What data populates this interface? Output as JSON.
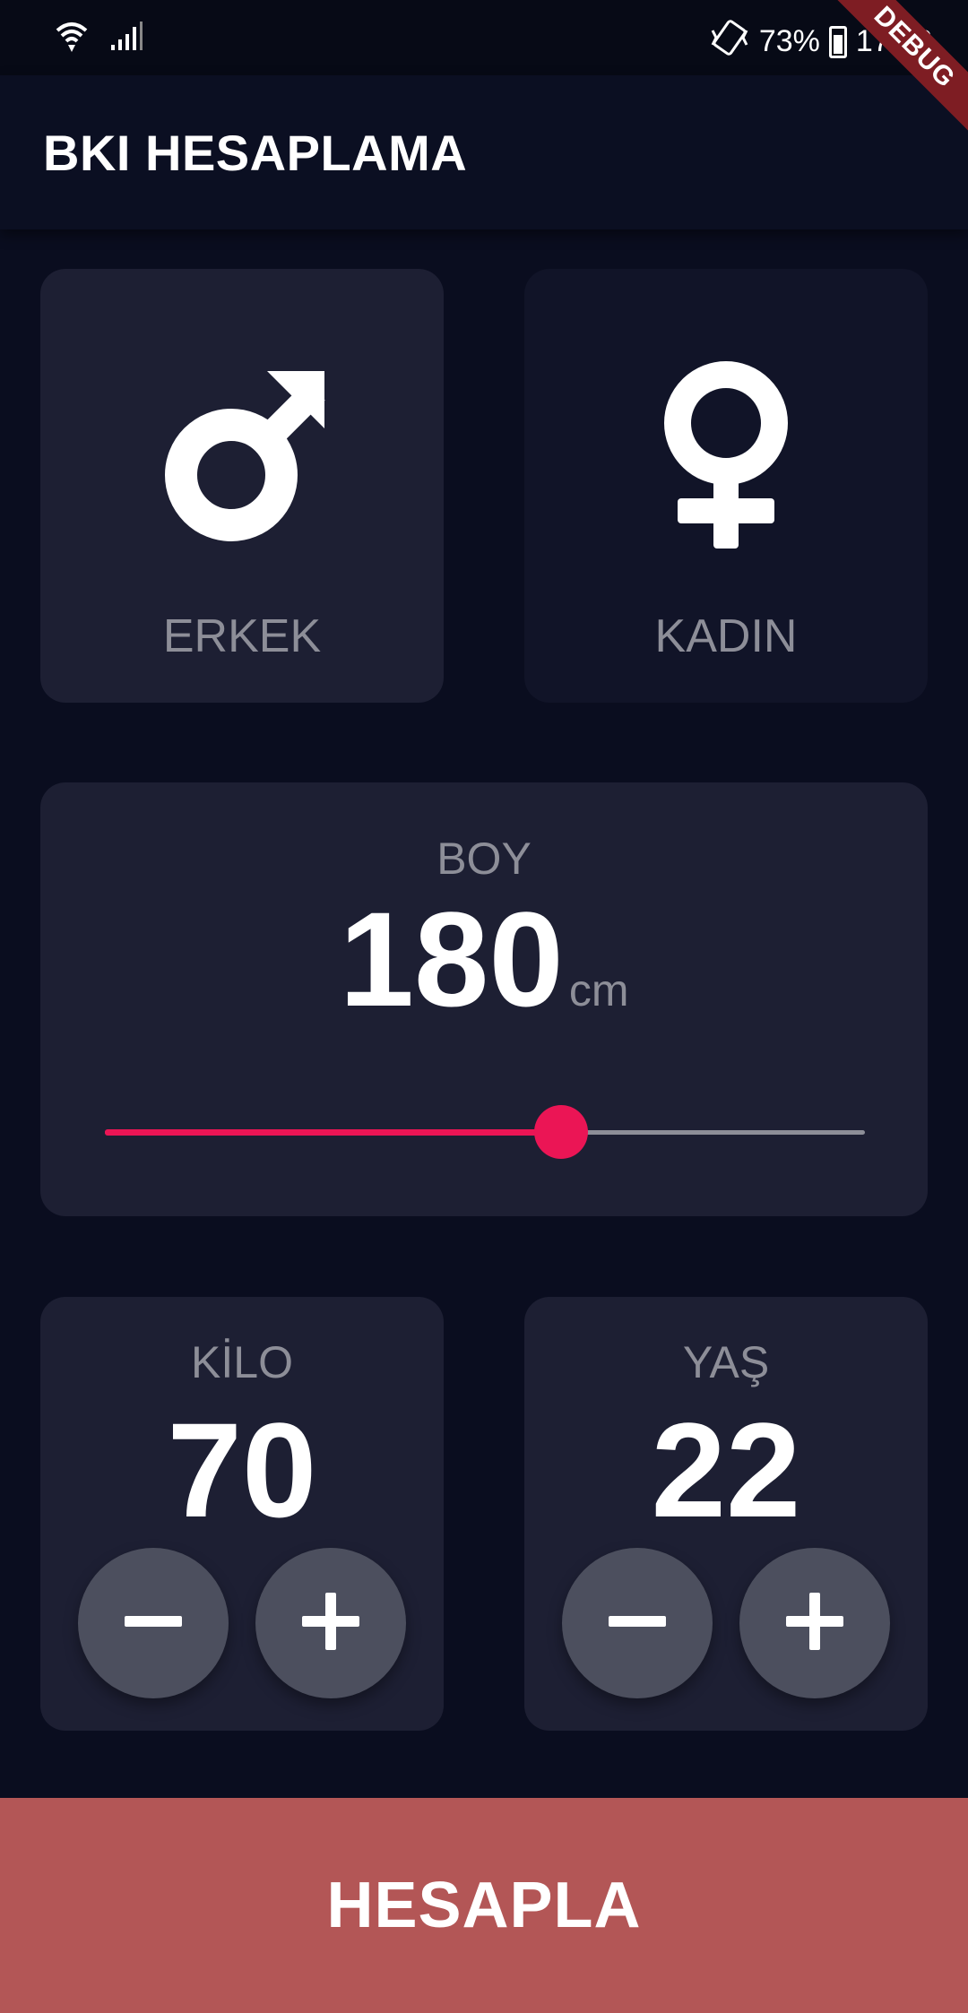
{
  "status_bar": {
    "battery": "73%",
    "time": "17:13",
    "icons": [
      "wifi-icon",
      "signal-icon",
      "vibrate-icon",
      "battery-icon"
    ]
  },
  "debug_banner": "DEBUG",
  "app_bar": {
    "title": "BKI HESAPLAMA"
  },
  "gender": {
    "male": {
      "label": "ERKEK",
      "icon": "male-symbol-icon"
    },
    "female": {
      "label": "KADIN",
      "icon": "female-symbol-icon"
    }
  },
  "height": {
    "label": "BOY",
    "value": "180",
    "unit": "cm",
    "slider_fraction": 0.6
  },
  "weight": {
    "label": "KİLO",
    "value": "70"
  },
  "age": {
    "label": "YAŞ",
    "value": "22"
  },
  "calculate_button": {
    "label": "HESAPLA"
  },
  "colors": {
    "background": "#0a0d1f",
    "card": "#1d1f33",
    "accent": "#eb1555",
    "button": "#b35656",
    "round_button": "#4c4f5e",
    "label": "#8d8e98"
  }
}
